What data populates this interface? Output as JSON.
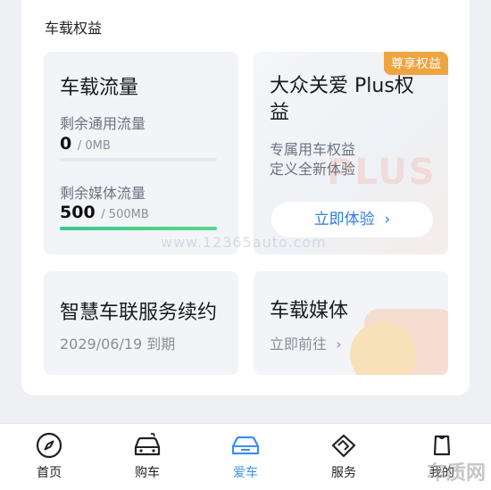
{
  "section": {
    "title": "车载权益"
  },
  "flow_card": {
    "title": "车载流量",
    "general": {
      "label": "剩余通用流量",
      "value": "0",
      "unit": "/ 0MB",
      "fill": 0
    },
    "media": {
      "label": "剩余媒体流量",
      "value": "500",
      "unit": "/ 500MB",
      "fill": 1
    }
  },
  "plus_card": {
    "badge": "尊享权益",
    "title_line1": "大众关爱 Plus权",
    "title_line2": "益",
    "desc_line1": "专属用车权益",
    "desc_line2": "定义全新体验",
    "bg_text": "PLUS",
    "cta": "立即体验"
  },
  "renew_card": {
    "title": "智慧车联服务续约",
    "expiry": "2029/06/19 到期"
  },
  "media_card": {
    "title": "车载媒体",
    "link": "立即前往"
  },
  "watermark": "www.12365auto.com",
  "tabs": [
    {
      "label": "首页",
      "icon": "compass-icon"
    },
    {
      "label": "购车",
      "icon": "car-cart-icon"
    },
    {
      "label": "爱车",
      "icon": "car-icon",
      "active": true
    },
    {
      "label": "服务",
      "icon": "handshake-icon"
    },
    {
      "label": "我的",
      "icon": "profile-icon"
    }
  ],
  "corner_mark": "车质网",
  "colors": {
    "accent": "#3c8ff0",
    "badge": "#f0a441",
    "progress": "#38c98b",
    "link": "#2a7de1"
  }
}
